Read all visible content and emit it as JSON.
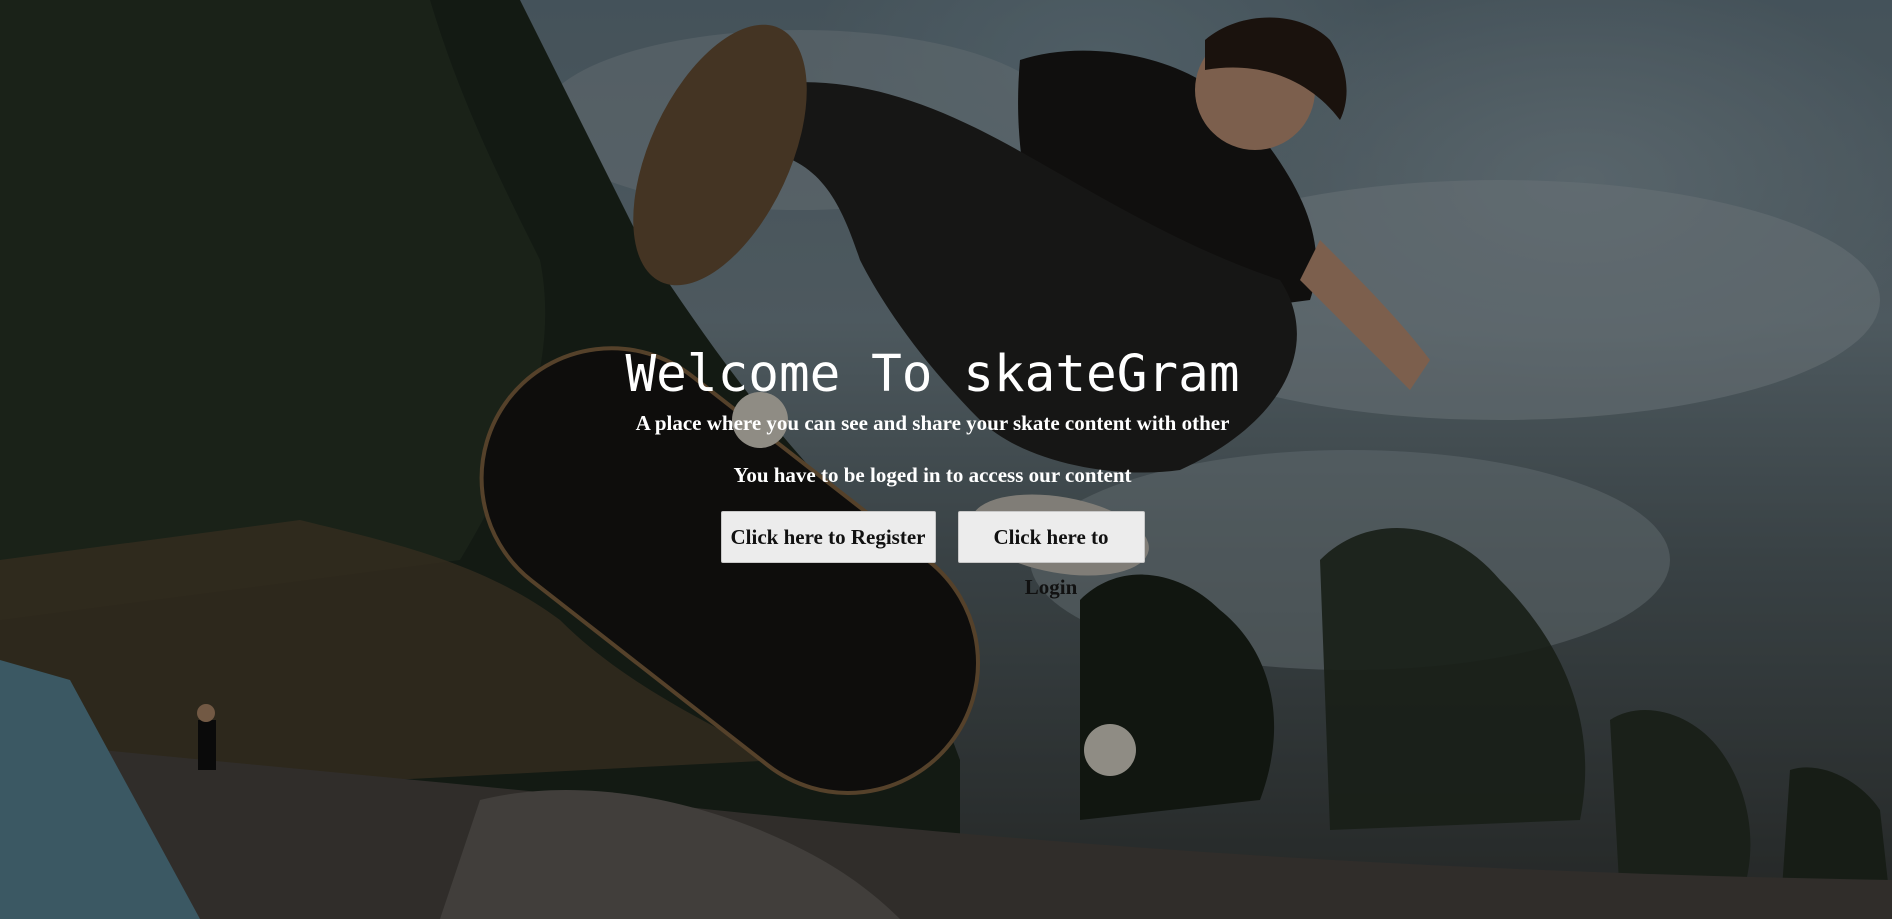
{
  "hero": {
    "title": "Welcome To skateGram",
    "subtitle": "A place where you can see and share your skate content with other",
    "notice": "You have to be loged in to access our content",
    "background_description_icon": "skateboarder-photo"
  },
  "buttons": {
    "register_label": "Click here to Register",
    "login_label": "Click here to Login"
  },
  "colors": {
    "text": "#ffffff",
    "button_bg": "#ececec",
    "button_text": "#111111",
    "overlay": "rgba(0,0,0,0.38)"
  }
}
